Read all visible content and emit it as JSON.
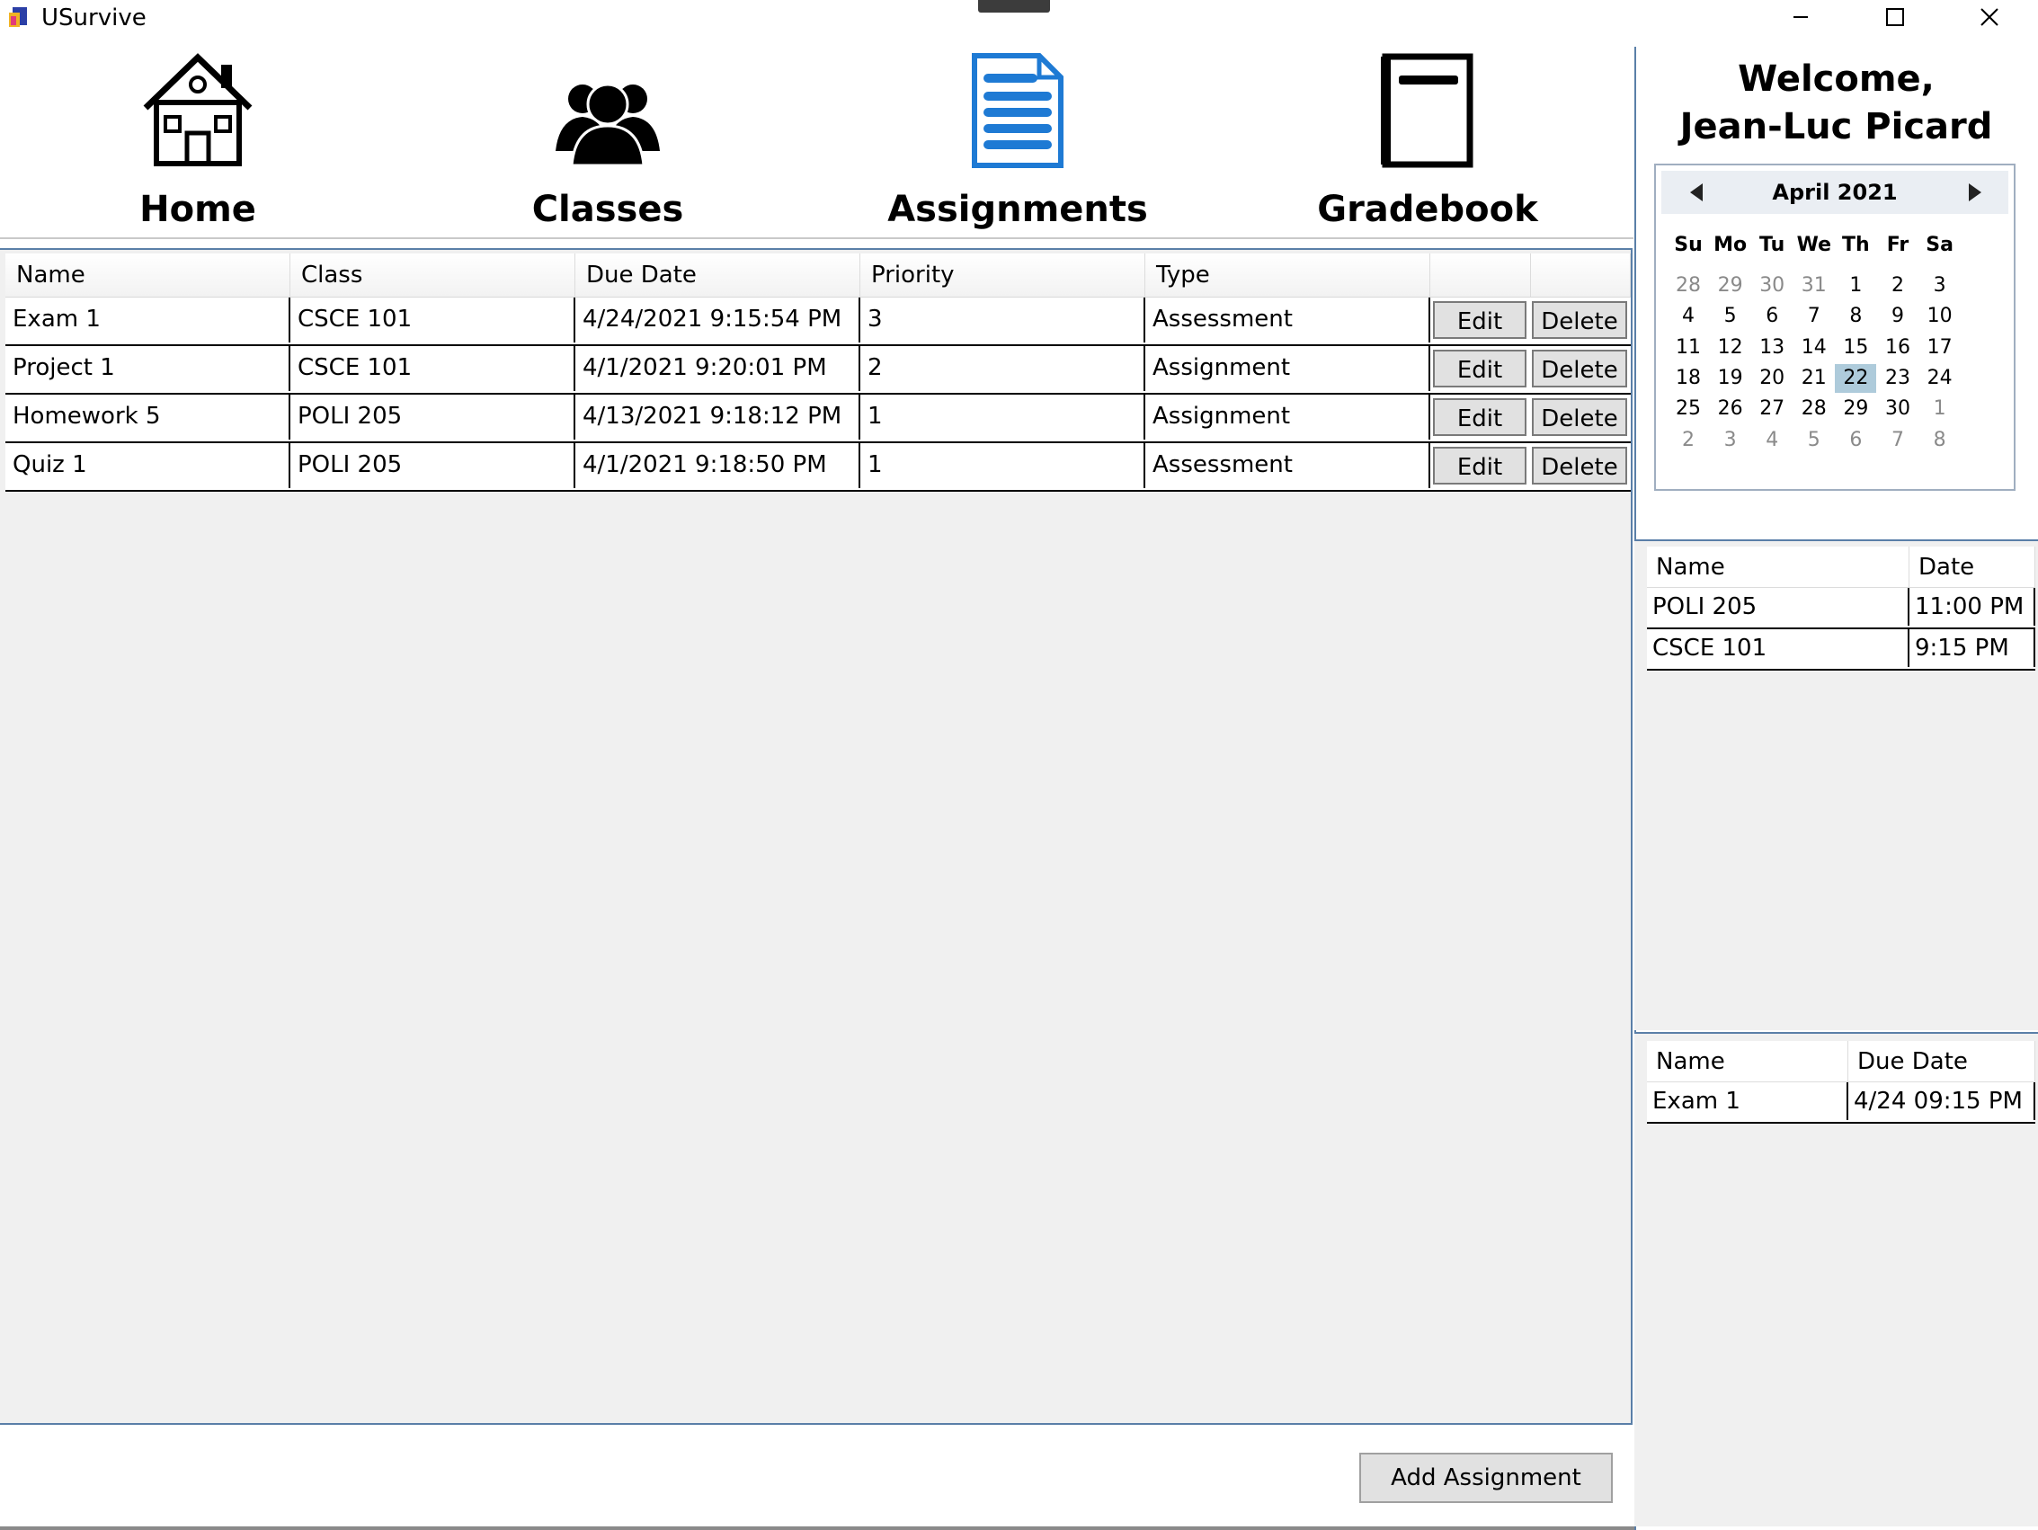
{
  "window": {
    "title": "USurvive",
    "controls": [
      "minimize-icon",
      "maximize-icon",
      "close-icon"
    ]
  },
  "nav": {
    "items": [
      {
        "label": "Home",
        "icon": "house-icon"
      },
      {
        "label": "Classes",
        "icon": "people-icon"
      },
      {
        "label": "Assignments",
        "icon": "document-icon",
        "active": true
      },
      {
        "label": "Gradebook",
        "icon": "book-icon"
      }
    ],
    "accent_color": "#1e7ad4"
  },
  "assignments_table": {
    "columns": [
      "Name",
      "Class",
      "Due Date",
      "Priority",
      "Type",
      "",
      ""
    ],
    "edit_label": "Edit",
    "delete_label": "Delete",
    "rows": [
      {
        "name": "Exam 1",
        "class": "CSCE 101",
        "due": "4/24/2021 9:15:54 PM",
        "priority": "3",
        "type": "Assessment"
      },
      {
        "name": "Project 1",
        "class": "CSCE 101",
        "due": "4/1/2021 9:20:01 PM",
        "priority": "2",
        "type": "Assignment"
      },
      {
        "name": "Homework 5",
        "class": "POLI 205",
        "due": "4/13/2021 9:18:12 PM",
        "priority": "1",
        "type": "Assignment"
      },
      {
        "name": "Quiz 1",
        "class": "POLI 205",
        "due": "4/1/2021 9:18:50 PM",
        "priority": "1",
        "type": "Assessment"
      }
    ]
  },
  "add_button_label": "Add Assignment",
  "sidebar": {
    "welcome_line1": "Welcome,",
    "welcome_line2": "Jean-Luc Picard",
    "calendar": {
      "month_label": "April 2021",
      "weekdays": [
        "Su",
        "Mo",
        "Tu",
        "We",
        "Th",
        "Fr",
        "Sa"
      ],
      "weeks": [
        [
          [
            "28",
            true
          ],
          [
            "29",
            true
          ],
          [
            "30",
            true
          ],
          [
            "31",
            true
          ],
          [
            "1",
            false
          ],
          [
            "2",
            false
          ],
          [
            "3",
            false
          ]
        ],
        [
          [
            "4",
            false
          ],
          [
            "5",
            false
          ],
          [
            "6",
            false
          ],
          [
            "7",
            false
          ],
          [
            "8",
            false
          ],
          [
            "9",
            false
          ],
          [
            "10",
            false
          ]
        ],
        [
          [
            "11",
            false
          ],
          [
            "12",
            false
          ],
          [
            "13",
            false
          ],
          [
            "14",
            false
          ],
          [
            "15",
            false
          ],
          [
            "16",
            false
          ],
          [
            "17",
            false
          ]
        ],
        [
          [
            "18",
            false
          ],
          [
            "19",
            false
          ],
          [
            "20",
            false
          ],
          [
            "21",
            false
          ],
          [
            "22",
            false
          ],
          [
            "23",
            false
          ],
          [
            "24",
            false
          ]
        ],
        [
          [
            "25",
            false
          ],
          [
            "26",
            false
          ],
          [
            "27",
            false
          ],
          [
            "28",
            false
          ],
          [
            "29",
            false
          ],
          [
            "30",
            false
          ],
          [
            "1",
            true
          ]
        ],
        [
          [
            "2",
            true
          ],
          [
            "3",
            true
          ],
          [
            "4",
            true
          ],
          [
            "5",
            true
          ],
          [
            "6",
            true
          ],
          [
            "7",
            true
          ],
          [
            "8",
            true
          ]
        ]
      ],
      "selected_day": "22",
      "selected_color": "#aecbdb"
    },
    "classes_today": {
      "columns": [
        "Name",
        "Date"
      ],
      "rows": [
        {
          "name": "POLI 205",
          "date": "11:00 PM"
        },
        {
          "name": "CSCE 101",
          "date": "9:15 PM"
        }
      ]
    },
    "upcoming": {
      "columns": [
        "Name",
        "Due Date"
      ],
      "rows": [
        {
          "name": "Exam 1",
          "date": "4/24 09:15 PM"
        }
      ]
    }
  }
}
